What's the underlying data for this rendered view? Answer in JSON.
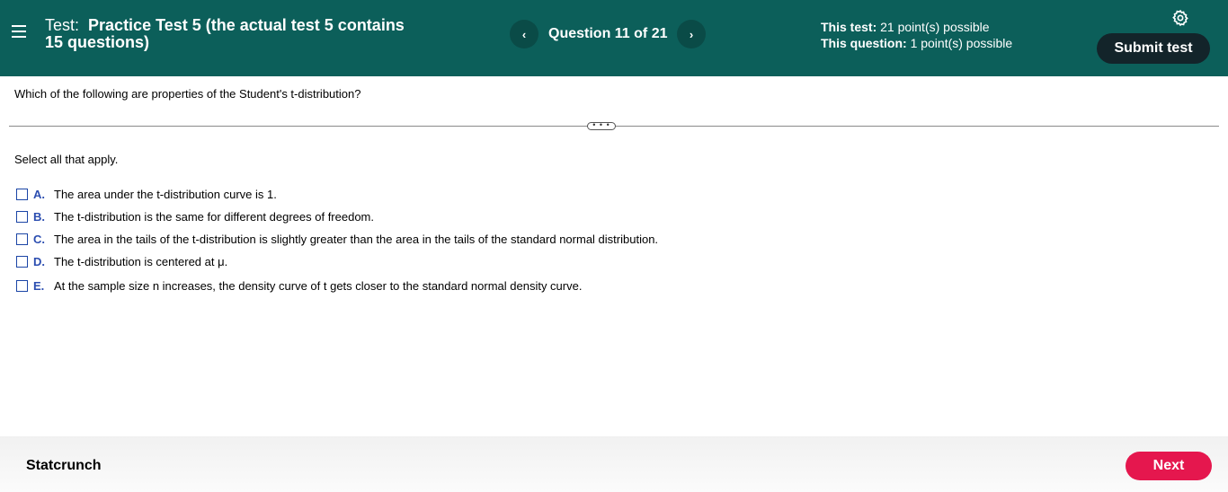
{
  "header": {
    "title_prefix": "Test:",
    "title_name": "Practice Test 5 (the actual test 5 contains 15 questions)",
    "question_counter": "Question 11 of 21",
    "prev_symbol": "‹",
    "next_symbol": "›",
    "test_points_label": "This test:",
    "test_points_value": "21 point(s) possible",
    "question_points_label": "This question:",
    "question_points_value": "1 point(s) possible",
    "submit_label": "Submit test",
    "colors": {
      "header_bg": "#0c5f5a",
      "submit_bg": "#13242a"
    }
  },
  "question": {
    "prompt": "Which of the following are properties of the Student's t-distribution?",
    "divider_handle": "• • •",
    "instruction": "Select all that apply.",
    "options": [
      {
        "letter": "A.",
        "text": "The area under the t-distribution curve is 1.",
        "checked": false
      },
      {
        "letter": "B.",
        "text": "The t-distribution is the same for different degrees of freedom.",
        "checked": false
      },
      {
        "letter": "C.",
        "text": "The area in the tails of the t-distribution is slightly greater than the area in the tails of the standard normal distribution.",
        "checked": false
      },
      {
        "letter": "D.",
        "text": "The t-distribution is centered at μ.",
        "checked": false
      },
      {
        "letter": "E.",
        "text": "At the sample size n increases, the density curve of t gets closer to the standard normal density curve.",
        "checked": false
      }
    ]
  },
  "footer": {
    "statcrunch_label": "Statcrunch",
    "next_label": "Next",
    "colors": {
      "next_bg": "#e5174e"
    }
  }
}
